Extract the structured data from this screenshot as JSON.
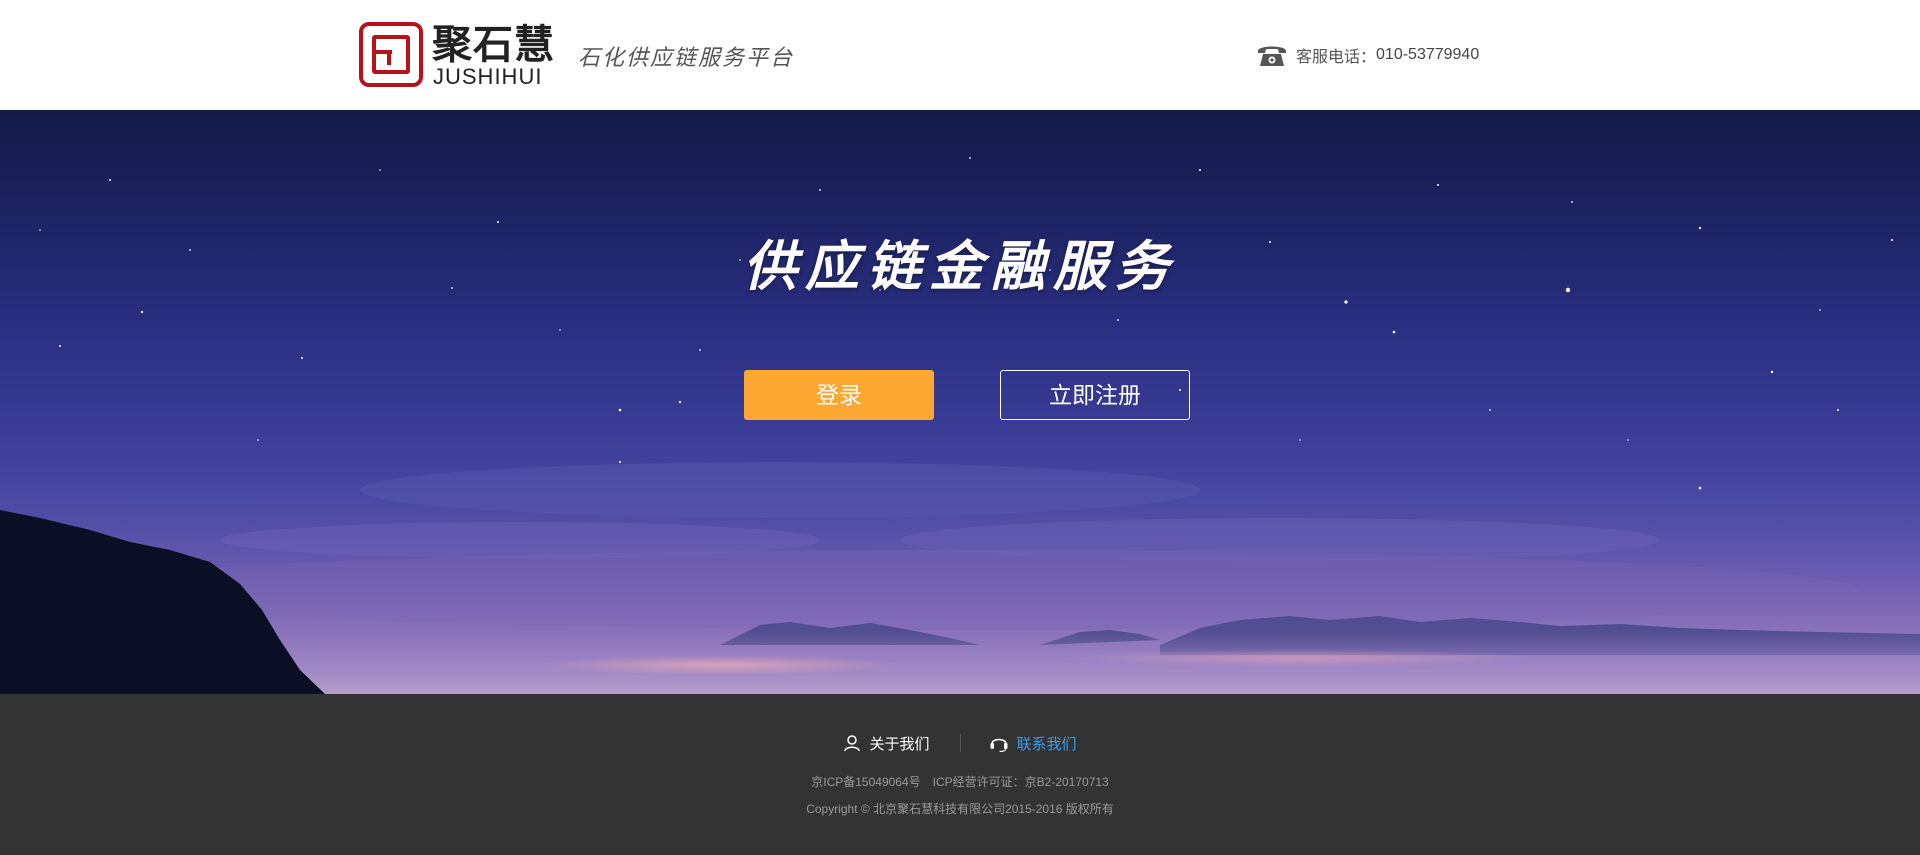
{
  "header": {
    "logo": {
      "cn": "聚石慧",
      "en": "JUSHIHUI",
      "brand_color": "#b5121b"
    },
    "slogan": "石化供应链服务平台",
    "phone": {
      "icon": "telephone-icon",
      "label": "客服电话：",
      "number": "010-53779940"
    }
  },
  "banner": {
    "title": "供应链金融服务",
    "login_button": "登录",
    "register_button": "立即注册",
    "colors": {
      "login_bg": "#fda733",
      "sky_top": "#141b48",
      "sky_bottom": "#a588c0"
    }
  },
  "footer": {
    "links": [
      {
        "label": "关于我们",
        "icon": "user-icon"
      },
      {
        "label": "联系我们",
        "icon": "headset-icon"
      }
    ],
    "icp": "京ICP备15049064号",
    "license": "ICP经营许可证：京B2-20170713",
    "copyright": "Copyright © 北京聚石慧科技有限公司2015-2016 版权所有",
    "colors": {
      "background": "#333333",
      "active_link": "#3c9be8"
    }
  }
}
